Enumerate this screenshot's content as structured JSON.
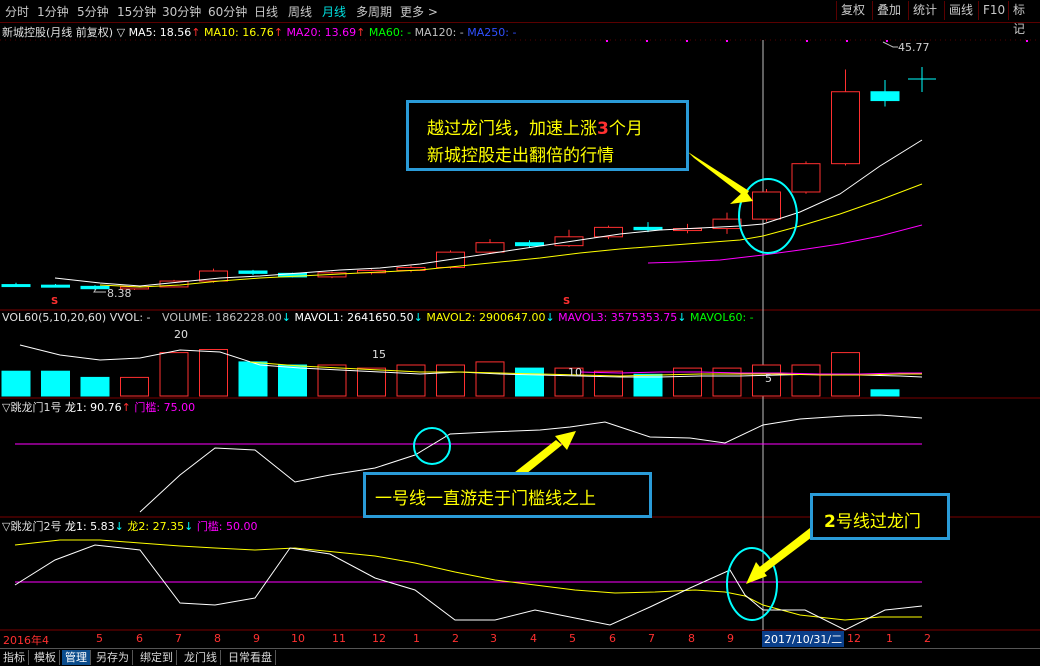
{
  "toolbar": {
    "tabs": [
      "分时",
      "1分钟",
      "5分钟",
      "15分钟",
      "30分钟",
      "60分钟",
      "日线",
      "周线",
      "月线",
      "多周期",
      "更多 >"
    ],
    "active_tab": "月线",
    "right_buttons": [
      "复权",
      "叠加",
      "统计",
      "画线",
      "F10",
      "标记"
    ]
  },
  "main": {
    "title": "新城控股(月线 前复权)",
    "ma5": "MA5: 18.56",
    "ma10": "MA10: 16.76",
    "ma20": "MA20: 13.69",
    "ma60": "MA60: -",
    "ma120": "MA120: -",
    "ma250": "MA250: -",
    "high_label": "45.77",
    "low_label": "8.38",
    "s_marks": [
      "S",
      "S"
    ],
    "colors": {
      "ma5": "#ffffff",
      "ma10": "#ffff00",
      "ma20": "#ff00ff",
      "ma60": "#00ff00",
      "ma120": "#c0c0c0",
      "ma250": "#3050ff",
      "up": "#ff3030",
      "down": "#00ffff"
    }
  },
  "volume": {
    "title": "VOL60(5,10,20,60)",
    "vvol": "VVOL: -",
    "volume": "VOLUME: 1862228.00",
    "mavol1": "MAVOL1: 2641650.50",
    "mavol2": "MAVOL2: 2900647.00",
    "mavol3": "MAVOL3: 3575353.75",
    "mavol60": "MAVOL60: -",
    "scale_labels": [
      "20",
      "15",
      "10",
      "5"
    ]
  },
  "ind1": {
    "title": "跳龙门1号",
    "long1": "龙1: 90.76",
    "threshold": "门槛: 75.00"
  },
  "ind2": {
    "title": "跳龙门2号",
    "long1": "龙1: 5.83",
    "long2": "龙2: 27.35",
    "threshold": "门槛: 50.00"
  },
  "callouts": {
    "c1_line1_a": "越过龙门线，加速上涨",
    "c1_line1_b": "3",
    "c1_line1_c": "个月",
    "c1_line2": "新城控股走出翻倍的行情",
    "c2": "一号线一直游走于门槛线之上",
    "c3_a": "2",
    "c3_b": "号线过龙门"
  },
  "xaxis": {
    "labels": [
      "2016年4",
      "5",
      "6",
      "7",
      "8",
      "9",
      "10",
      "11",
      "12",
      "1",
      "2",
      "3",
      "4",
      "5",
      "6",
      "7",
      "8",
      "9",
      "2017/10/31/二",
      "12",
      "1",
      "2"
    ]
  },
  "bottom_buttons": [
    "指标",
    "模板",
    "管理",
    "另存为",
    "绑定到",
    "龙门线",
    "日常看盘"
  ],
  "bottom_active": "管理",
  "chart_data": {
    "type": "candlestick",
    "categories": [
      "2016-04",
      "2016-05",
      "2016-06",
      "2016-07",
      "2016-08",
      "2016-09",
      "2016-10",
      "2016-11",
      "2016-12",
      "2017-01",
      "2017-02",
      "2017-03",
      "2017-04",
      "2017-05",
      "2017-06",
      "2017-07",
      "2017-08",
      "2017-09",
      "2017-10",
      "2017-11",
      "2017-12",
      "2018-01",
      "2018-02"
    ],
    "ohlc": [
      [
        9.3,
        9.6,
        8.9,
        9.2
      ],
      [
        9.2,
        9.4,
        8.9,
        9.1
      ],
      [
        9.0,
        9.2,
        8.4,
        8.6
      ],
      [
        8.6,
        9.0,
        8.38,
        8.9
      ],
      [
        8.9,
        10.1,
        8.8,
        9.9
      ],
      [
        9.9,
        12.0,
        9.6,
        11.6
      ],
      [
        11.6,
        11.8,
        10.9,
        11.2
      ],
      [
        11.2,
        11.3,
        10.5,
        10.6
      ],
      [
        10.6,
        11.5,
        10.4,
        11.3
      ],
      [
        11.3,
        11.9,
        11.0,
        11.7
      ],
      [
        11.7,
        12.5,
        11.4,
        12.2
      ],
      [
        12.2,
        15.1,
        12.0,
        14.8
      ],
      [
        14.8,
        17.0,
        14.5,
        16.4
      ],
      [
        16.4,
        16.8,
        15.6,
        15.9
      ],
      [
        15.9,
        18.6,
        15.7,
        17.4
      ],
      [
        17.4,
        19.3,
        17.0,
        19.0
      ],
      [
        19.0,
        19.9,
        18.2,
        18.6
      ],
      [
        18.6,
        19.6,
        18.0,
        18.8
      ],
      [
        18.8,
        21.5,
        17.9,
        20.4
      ],
      [
        20.4,
        25.5,
        20.0,
        25.0
      ],
      [
        25.0,
        30.2,
        24.7,
        29.8
      ],
      [
        29.8,
        45.77,
        29.5,
        42.0
      ],
      [
        42.0,
        44.0,
        39.5,
        40.5
      ]
    ],
    "ma5_last": 18.56,
    "ma10_last": 16.76,
    "ma20_last": 13.69,
    "volume": [
      8,
      8,
      6,
      6,
      14,
      15,
      11,
      10,
      10,
      9,
      10,
      10,
      11,
      9,
      9,
      8,
      7,
      9,
      9,
      10,
      10,
      14,
      2
    ],
    "ind1_long1": [
      10,
      15,
      15,
      20,
      30,
      40,
      50,
      50,
      40,
      45,
      48,
      55,
      70,
      82,
      84,
      84,
      86,
      90,
      87,
      85,
      80,
      86,
      90,
      91,
      91
    ],
    "ind1_threshold": 75,
    "ind2_long1": [
      42,
      46,
      44,
      40,
      10,
      12,
      10,
      12,
      50,
      45,
      35,
      20,
      8,
      10,
      9,
      8,
      5,
      12,
      25,
      35,
      48,
      20,
      3,
      12,
      18,
      20
    ],
    "ind2_long2": [
      62,
      60,
      58,
      58,
      52,
      50,
      48,
      48,
      46,
      44,
      40,
      38,
      36,
      34,
      32,
      30,
      30,
      30,
      32,
      30,
      28,
      22,
      12,
      12,
      11,
      10
    ],
    "ind2_threshold": 50
  }
}
